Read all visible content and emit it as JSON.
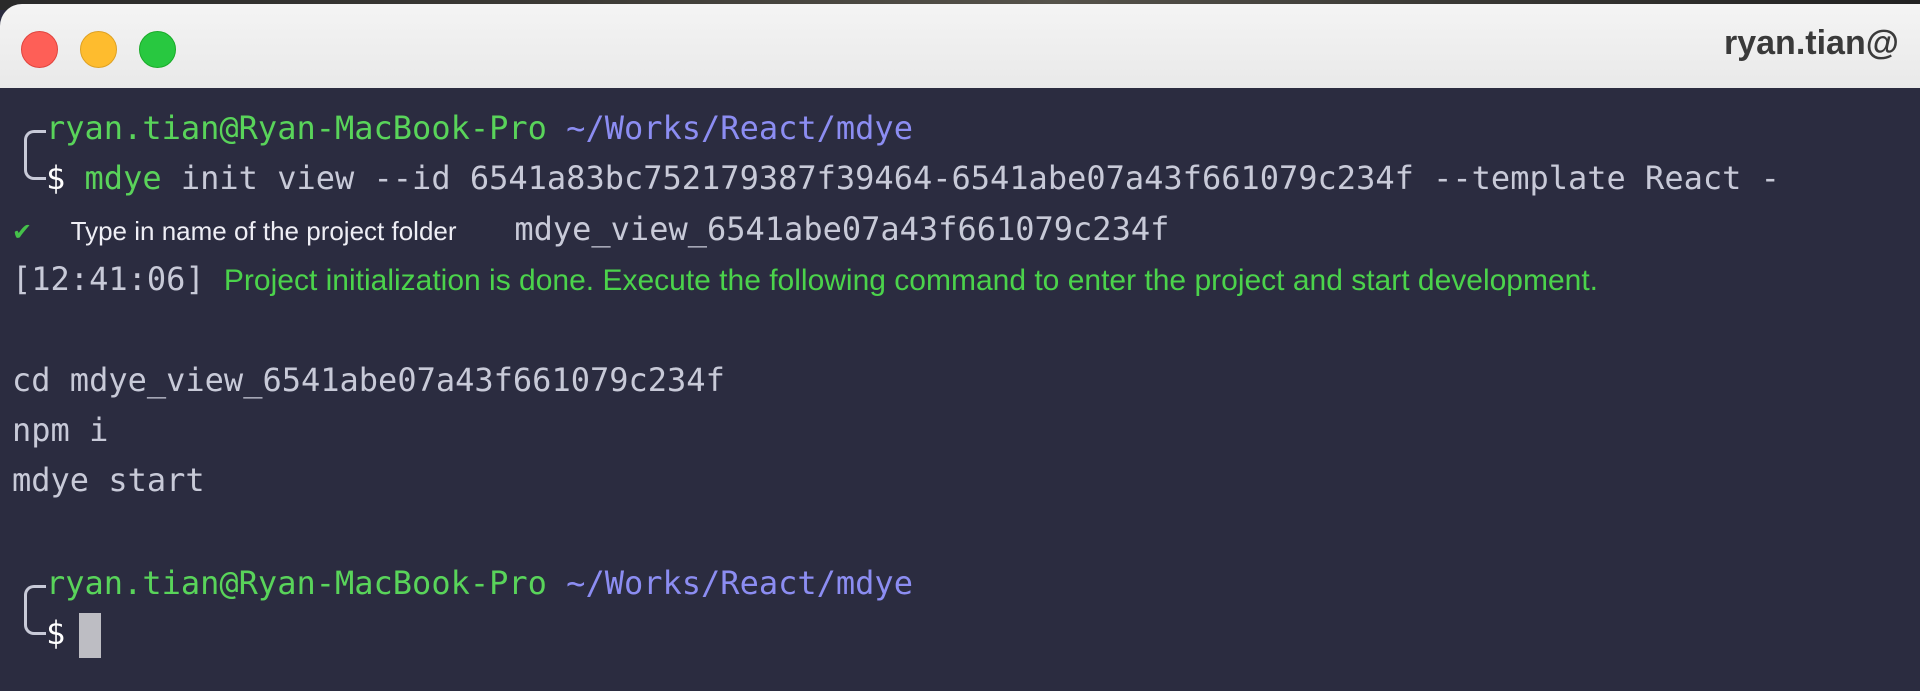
{
  "window": {
    "title": "ryan.tian@",
    "buttons": {
      "close": "close-button",
      "minimize": "minimize-button",
      "zoom": "zoom-button"
    }
  },
  "colors": {
    "background": "#2b2c40",
    "user": "#59d45a",
    "path": "#8c8df2",
    "success": "#4bd34b"
  },
  "terminal": {
    "prompt1": {
      "user_host": "ryan.tian@Ryan-MacBook-Pro",
      "path": "~/Works/React/mdye",
      "symbol": "$",
      "command": "mdye",
      "arguments": "init view --id 6541a83bc752179387f39464-6541abe07a43f661079c234f --template React -"
    },
    "question": {
      "check": "✔",
      "label": "Type in name of the project folder",
      "answer": "mdye_view_6541abe07a43f661079c234f"
    },
    "status": {
      "timestamp": "[12:41:06]",
      "message": "Project initialization is done. Execute the following command to enter the project and start development."
    },
    "instructions": [
      "cd mdye_view_6541abe07a43f661079c234f",
      "npm i",
      "mdye start"
    ],
    "prompt2": {
      "user_host": "ryan.tian@Ryan-MacBook-Pro",
      "path": "~/Works/React/mdye",
      "symbol": "$"
    }
  }
}
